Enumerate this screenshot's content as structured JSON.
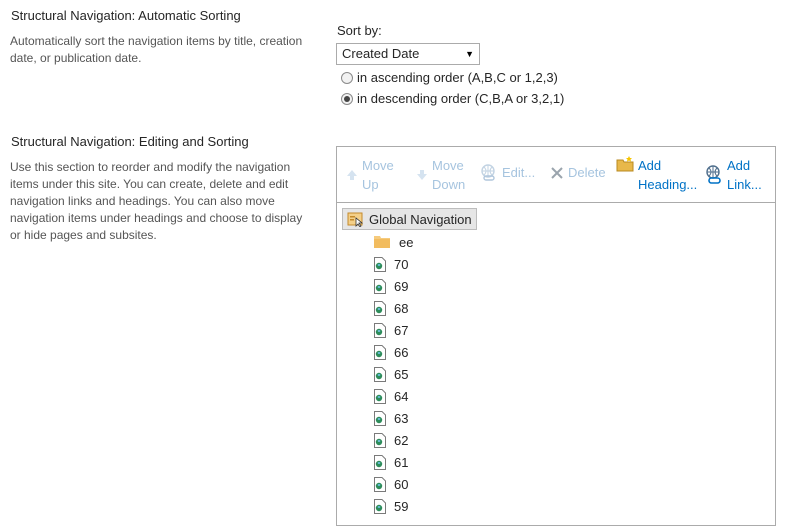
{
  "sorting": {
    "title": "Structural Navigation: Automatic Sorting",
    "description": "Automatically sort the navigation items by title, creation date, or publication date.",
    "sort_by_label": "Sort by:",
    "sort_by_value": "Created Date",
    "order_options": [
      {
        "label": "in ascending order (A,B,C or 1,2,3)",
        "checked": false
      },
      {
        "label": "in descending order (C,B,A or 3,2,1)",
        "checked": true
      }
    ]
  },
  "editing": {
    "title": "Structural Navigation: Editing and Sorting",
    "description": "Use this section to reorder and modify the navigation items under this site. You can create, delete and edit navigation links and headings. You can also move navigation items under headings and choose to display or hide pages and subsites."
  },
  "toolbar": {
    "move_up": [
      "Move",
      "Up"
    ],
    "move_down": [
      "Move",
      "Down"
    ],
    "edit": "Edit...",
    "delete": "Delete",
    "add_heading": [
      "Add",
      "Heading..."
    ],
    "add_link": [
      "Add",
      "Link..."
    ]
  },
  "tree": {
    "root": "Global Navigation",
    "items": [
      "ee",
      "70",
      "69",
      "68",
      "67",
      "66",
      "65",
      "64",
      "63",
      "62",
      "61",
      "60",
      "59"
    ]
  },
  "colors": {
    "link_blue": "#0072c6",
    "disabled_blue": "#a6c4df"
  }
}
